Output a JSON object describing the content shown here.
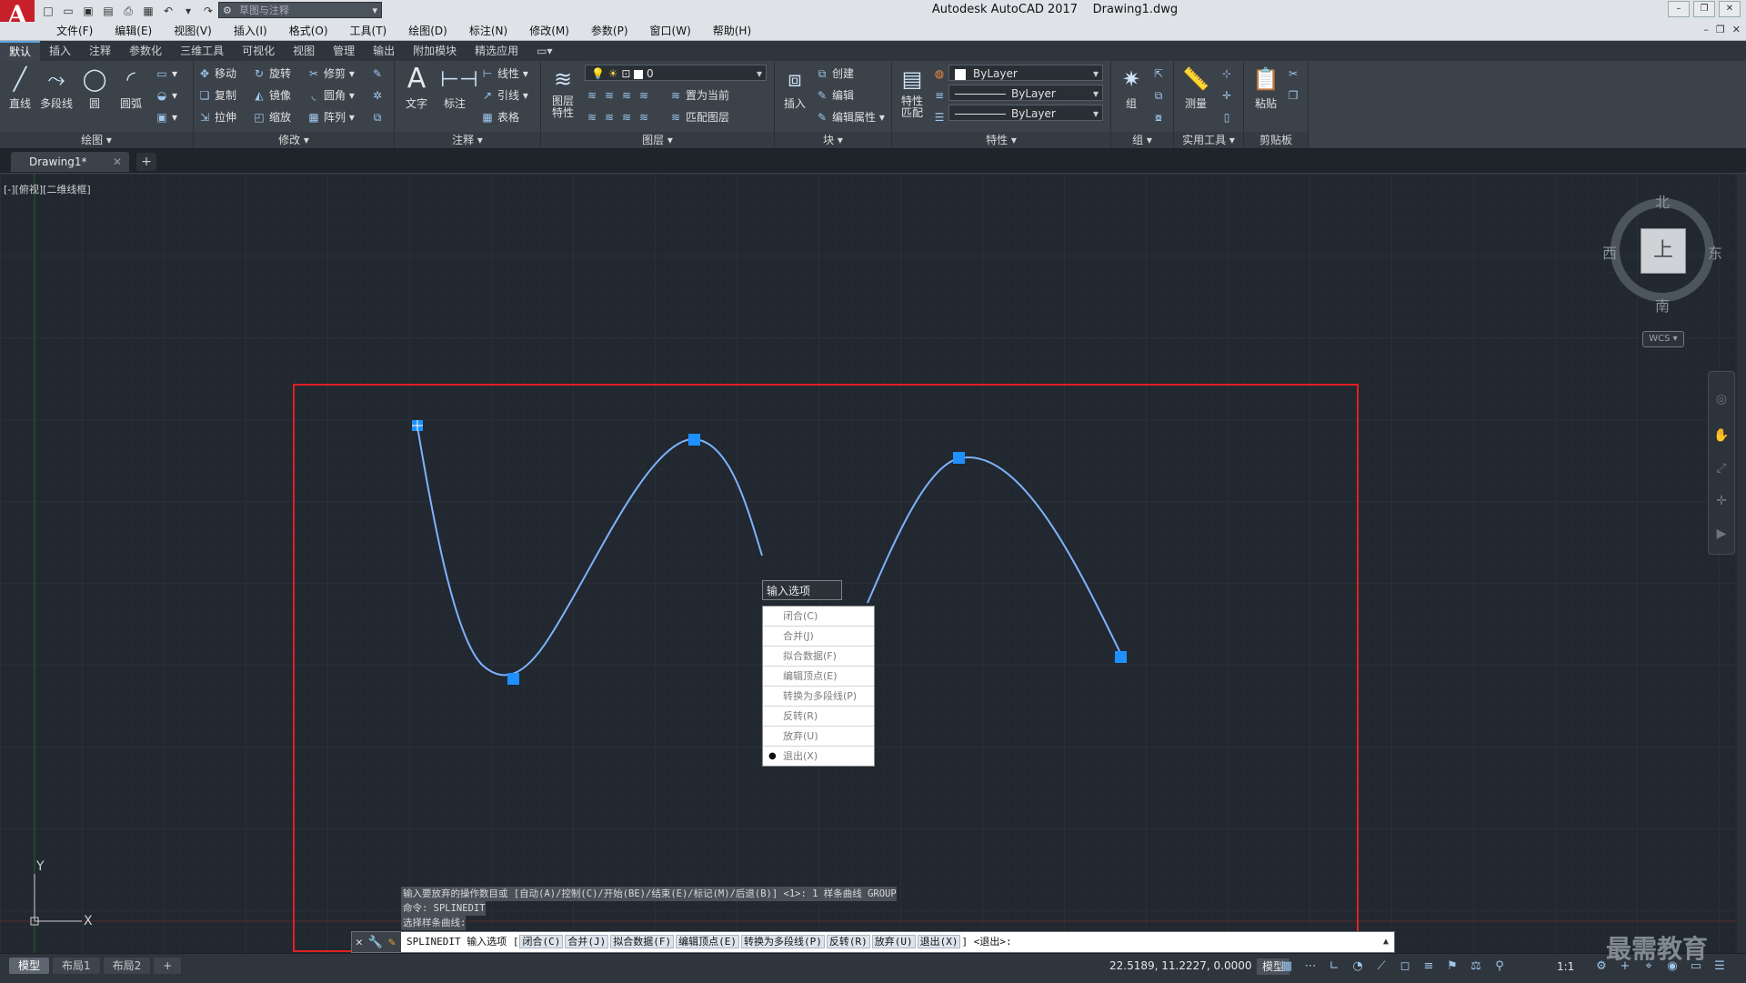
{
  "app": {
    "logo": "A",
    "window_title": "Autodesk AutoCAD 2017    Drawing1.dwg",
    "workspace": "草图与注释",
    "colors": {
      "accent": "#1e90ff",
      "selection_frame": "#e02020",
      "canvas_bg": "#212830"
    }
  },
  "menus": [
    "文件(F)",
    "编辑(E)",
    "视图(V)",
    "插入(I)",
    "格式(O)",
    "工具(T)",
    "绘图(D)",
    "标注(N)",
    "修改(M)",
    "参数(P)",
    "窗口(W)",
    "帮助(H)"
  ],
  "ribbon_tabs": [
    "默认",
    "插入",
    "注释",
    "参数化",
    "三维工具",
    "可视化",
    "视图",
    "管理",
    "输出",
    "附加模块",
    "精选应用"
  ],
  "ribbon": {
    "draw": {
      "title": "绘图",
      "line": "直线",
      "polyline": "多段线",
      "circle": "圆",
      "arc": "圆弧"
    },
    "modify": {
      "title": "修改",
      "move": "移动",
      "rotate": "旋转",
      "trim": "修剪",
      "copy": "复制",
      "mirror": "镜像",
      "fillet": "圆角",
      "stretch": "拉伸",
      "scale": "缩放",
      "array": "阵列"
    },
    "annotation": {
      "title": "注释",
      "text": "文字",
      "dimension": "标注",
      "linear": "线性",
      "leader": "引线",
      "table": "表格"
    },
    "layers": {
      "title": "图层",
      "layer_props": "图层\n特性",
      "current_layer": "0",
      "set_current": "置为当前",
      "match_layer": "匹配图层"
    },
    "block": {
      "title": "块",
      "insert": "插入",
      "create": "创建",
      "edit": "编辑",
      "edit_attr": "编辑属性"
    },
    "properties": {
      "title": "特性",
      "match": "特性\n匹配",
      "color": "ByLayer",
      "linetype": "ByLayer",
      "lineweight": "ByLayer"
    },
    "groups": {
      "title": "组",
      "group": "组"
    },
    "utilities": {
      "title": "实用工具",
      "measure": "测量"
    },
    "clipboard": {
      "title": "剪贴板",
      "paste": "粘贴"
    }
  },
  "file_tab": {
    "name": "Drawing1*"
  },
  "viewport": {
    "label": "[-][俯视][二维线框]"
  },
  "viewcube": {
    "north": "北",
    "south": "南",
    "east": "东",
    "west": "西",
    "face": "上",
    "wcs": "WCS"
  },
  "ucs": {
    "x": "X",
    "y": "Y"
  },
  "context_menu": {
    "title": "输入选项",
    "items": [
      "闭合(C)",
      "合并(J)",
      "拟合数据(F)",
      "编辑顶点(E)",
      "转换为多段线(P)",
      "反转(R)",
      "放弃(U)",
      "退出(X)"
    ],
    "selected_index": 7
  },
  "command_history": [
    "输入要放弃的操作数目或 [自动(A)/控制(C)/开始(BE)/结束(E)/标记(M)/后退(B)] <1>: 1 样条曲线 GROUP",
    "命令: SPLINEDIT",
    "选择样条曲线:"
  ],
  "command_line": {
    "prefix": "SPLINEDIT 输入选项 [",
    "options": [
      "闭合(C)",
      "合并(J)",
      "拟合数据(F)",
      "编辑顶点(E)",
      "转换为多段线(P)",
      "反转(R)",
      "放弃(U)",
      "退出(X)"
    ],
    "suffix": "] <退出>:"
  },
  "layout_tabs": [
    "模型",
    "布局1",
    "布局2"
  ],
  "status": {
    "coords": "22.5189, 11.2227, 0.0000",
    "model": "模型",
    "scale": "1:1"
  },
  "watermark": "最需教育"
}
